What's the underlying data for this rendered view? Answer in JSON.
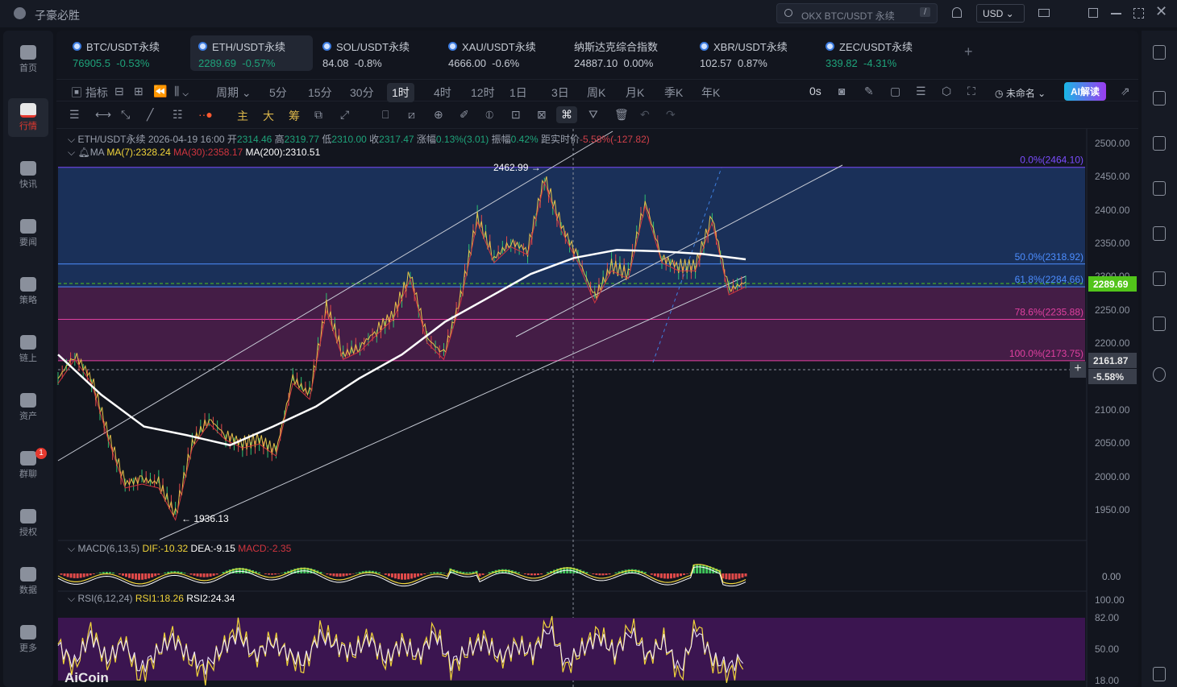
{
  "app": {
    "title": "子豪必胜",
    "search_placeholder": "OKX BTC/USDT 永续",
    "search_shortcut": "/",
    "currency": "USD"
  },
  "nav": [
    {
      "label": "首页"
    },
    {
      "label": "行情",
      "active": true
    },
    {
      "label": "快讯"
    },
    {
      "label": "要闻"
    },
    {
      "label": "策略"
    },
    {
      "label": "链上"
    },
    {
      "label": "资产"
    },
    {
      "label": "群聊",
      "badge": "1"
    },
    {
      "label": "授权"
    },
    {
      "label": "数据"
    },
    {
      "label": "更多"
    }
  ],
  "tabs": [
    {
      "name": "BTC/USDT永续",
      "price": "76905.5",
      "change": "-0.53%",
      "color": "green"
    },
    {
      "name": "ETH/USDT永续",
      "price": "2289.69",
      "change": "-0.57%",
      "color": "green",
      "selected": true
    },
    {
      "name": "SOL/USDT永续",
      "price": "84.08",
      "change": "-0.8%",
      "color": "white"
    },
    {
      "name": "XAU/USDT永续",
      "price": "4666.00",
      "change": "-0.6%",
      "color": "white"
    },
    {
      "name": "纳斯达克综合指数",
      "price": "24887.10",
      "change": "0.00%",
      "color": "white"
    },
    {
      "name": "XBR/USDT永续",
      "price": "102.57",
      "change": "0.87%",
      "color": "white"
    },
    {
      "name": "ZEC/USDT永续",
      "price": "339.82",
      "change": "-4.31%",
      "color": "green"
    }
  ],
  "toolbar": {
    "indicator": "指标",
    "period": "周期",
    "periods": [
      "5分",
      "15分",
      "30分",
      "1时",
      "4时",
      "12时",
      "1日",
      "3日",
      "周K",
      "月K",
      "季K",
      "年K"
    ],
    "selected_period": "1时",
    "countdown": "0s",
    "layout_name": "未命名",
    "ai_label": "AI解读"
  },
  "drawtools": {
    "main": "主",
    "big": "大",
    "chip": "筹"
  },
  "info": {
    "symbol": "ETH/USDT永续",
    "time": "2026-04-19 16:00",
    "open_l": "开",
    "open": "2314.46",
    "high_l": "高",
    "high": "2319.77",
    "low_l": "低",
    "low": "2310.00",
    "close_l": "收",
    "close": "2317.47",
    "chg_l": "涨幅",
    "chg": "0.13%(3.01)",
    "amp_l": "振幅",
    "amp": "0.42%",
    "dist_l": "距实时价",
    "dist": "-5.58%(-127.82)"
  },
  "ma": {
    "label": "MA",
    "ma7": "MA(7):2328.24",
    "ma30": "MA(30):2358.17",
    "ma200": "MA(200):2310.51"
  },
  "macd": {
    "label": "MACD(6,13,5)",
    "dif": "DIF:-10.32",
    "dea": "DEA:-9.15",
    "macd": "MACD:-2.35",
    "axis": "0.00"
  },
  "rsi": {
    "label": "RSI(6,12,24)",
    "rsi1": "RSI1:18.26",
    "rsi2": "RSI2:24.34",
    "axis": [
      "100.00",
      "82.00",
      "50.00",
      "18.00"
    ]
  },
  "watermark": "AiCoin",
  "colors": {
    "up": "#1ea37a",
    "down": "#e0404a",
    "last": "#52c41a",
    "fib_blue": "#2a4a8a",
    "fib_pink": "#5a2358"
  },
  "chart_data": {
    "type": "line",
    "title": "ETH/USDT永续 1H",
    "ylim": [
      1920,
      2510
    ],
    "yticks": [
      "2500.00",
      "2450.00",
      "2400.00",
      "2350.00",
      "2300.00",
      "2250.00",
      "2200.00",
      "2150.00",
      "2100.00",
      "2050.00",
      "2000.00",
      "1950.00"
    ],
    "price": [
      2147,
      2183,
      2147,
      2062,
      1990,
      1996,
      1990,
      1942,
      2050,
      2087,
      2062,
      2050,
      2056,
      2038,
      2147,
      2123,
      2256,
      2183,
      2195,
      2220,
      2244,
      2304,
      2208,
      2183,
      2268,
      2389,
      2328,
      2352,
      2340,
      2449,
      2377,
      2328,
      2268,
      2316,
      2304,
      2413,
      2328,
      2316,
      2316,
      2389,
      2280,
      2292
    ],
    "ma200": [
      2183,
      2123,
      2075,
      2062,
      2047,
      2075,
      2105,
      2147,
      2183,
      2232,
      2268,
      2304,
      2328,
      2340,
      2338,
      2334,
      2326
    ],
    "high_label": "2462.99",
    "low_label": "1936.13",
    "last_price": "2289.69",
    "cursor_price": "2161.87",
    "cursor_pct": "-5.58%",
    "fib": [
      {
        "label": "0.0%(2464.10)",
        "value": 2464.1,
        "color": "#7b4dff"
      },
      {
        "label": "50.0%(2318.92)",
        "value": 2318.92,
        "color": "#4c8dff"
      },
      {
        "label": "61.8%(2284.66)",
        "value": 2284.66,
        "color": "#4c8dff"
      },
      {
        "label": "78.6%(2235.88)",
        "value": 2235.88,
        "color": "#e040a0"
      },
      {
        "label": "100.0%(2173.75)",
        "value": 2173.75,
        "color": "#e040a0"
      }
    ],
    "rsi": [
      55,
      30,
      70,
      35,
      60,
      20,
      45,
      65,
      40,
      25,
      50,
      72,
      40,
      60,
      45,
      30,
      70,
      55,
      45,
      65,
      35,
      58,
      40,
      72,
      30,
      48,
      62,
      38,
      55,
      45,
      80,
      30,
      50,
      68,
      45,
      75,
      40,
      60,
      20,
      78,
      35,
      25,
      40
    ]
  }
}
